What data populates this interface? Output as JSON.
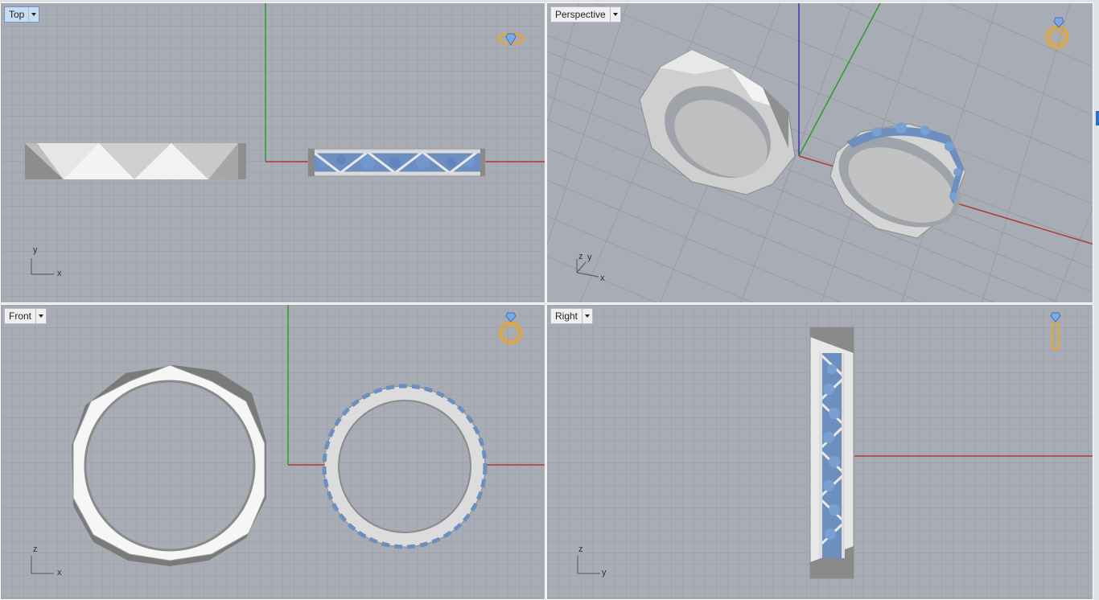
{
  "viewports": [
    {
      "id": "top",
      "title": "Top",
      "active": true,
      "axis_labels": [
        "y",
        "x"
      ]
    },
    {
      "id": "perspective",
      "title": "Perspective",
      "active": false,
      "axis_labels": [
        "z",
        "y",
        "x"
      ]
    },
    {
      "id": "front",
      "title": "Front",
      "active": false,
      "axis_labels": [
        "z",
        "x"
      ]
    },
    {
      "id": "right",
      "title": "Right",
      "active": false,
      "axis_labels": [
        "z",
        "y"
      ]
    }
  ],
  "colors": {
    "grid_bg": "#a8adb5",
    "grid_line": "#9499a1",
    "grid_major": "#868b93",
    "x_axis": "#b03a2e",
    "y_axis": "#2e9a2e",
    "z_axis": "#3a3ab0",
    "gem": "#6d8fc0",
    "metal": "#d9d9d9",
    "widget": "#f0a520"
  },
  "icons": [
    "ring-widget-icon",
    "dropdown-arrow-icon"
  ]
}
